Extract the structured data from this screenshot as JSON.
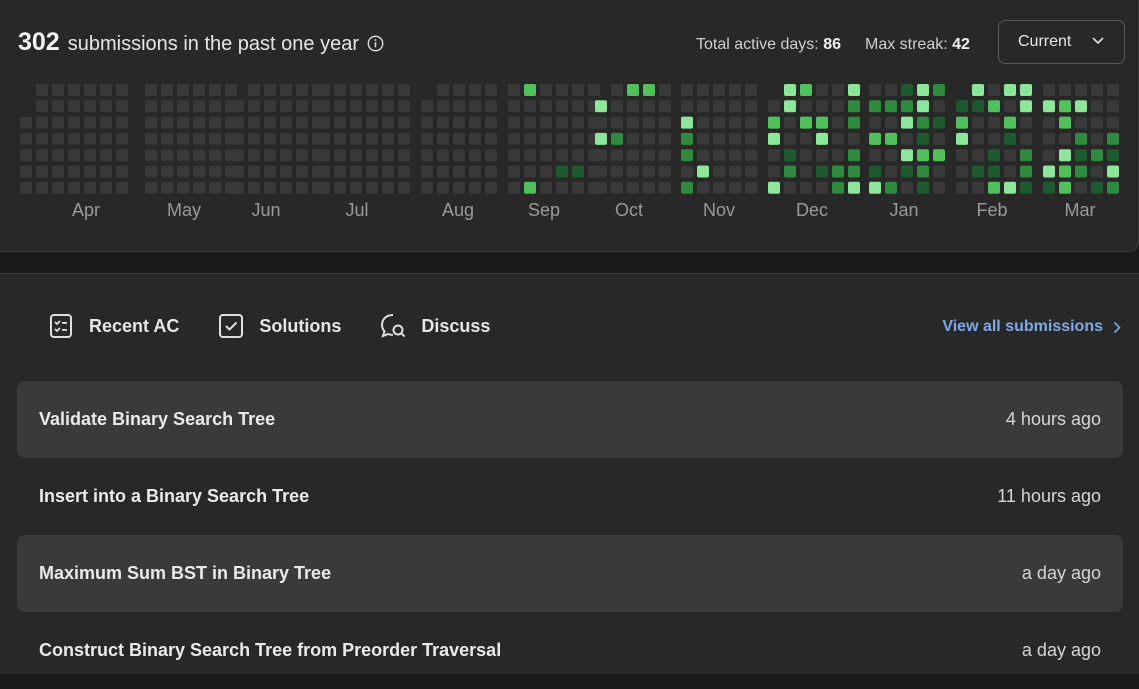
{
  "summary": {
    "count": "302",
    "text": "submissions in the past one year"
  },
  "stats": {
    "active_label": "Total active days:",
    "active_value": "86",
    "streak_label": "Max streak:",
    "streak_value": "42"
  },
  "year_select": {
    "value": "Current"
  },
  "heatmap": {
    "months": [
      "Apr",
      "May",
      "Jun",
      "Jul",
      "Aug",
      "Sep",
      "Oct",
      "Nov",
      "Dec",
      "Jan",
      "Feb",
      "Mar"
    ],
    "colors": {
      "empty": "#393939",
      "l1": "#1e5a2e",
      "l2": "#2f8a3f",
      "l3": "#4fc05a",
      "l4": "#8ee69a"
    }
  },
  "tabs": [
    {
      "label": "Recent AC",
      "icon": "checklist-icon"
    },
    {
      "label": "Solutions",
      "icon": "check-square-icon"
    },
    {
      "label": "Discuss",
      "icon": "chat-search-icon"
    }
  ],
  "view_all": "View all submissions",
  "submissions": [
    {
      "title": "Validate Binary Search Tree",
      "time": "4 hours ago"
    },
    {
      "title": "Insert into a Binary Search Tree",
      "time": "11 hours ago"
    },
    {
      "title": "Maximum Sum BST in Binary Tree",
      "time": "a day ago"
    },
    {
      "title": "Construct Binary Search Tree from Preorder Traversal",
      "time": "a day ago"
    }
  ]
}
